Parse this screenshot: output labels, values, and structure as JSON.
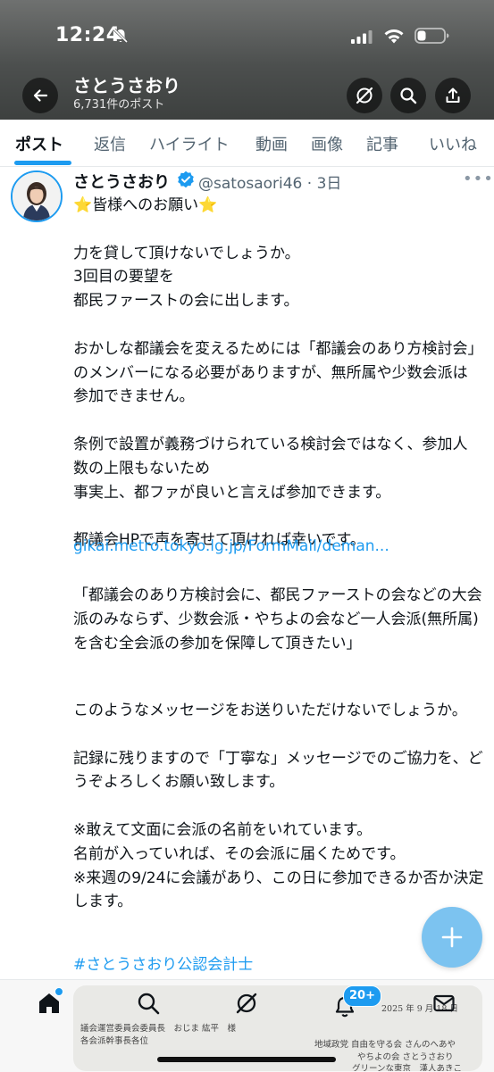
{
  "status_bar": {
    "time": "12:24"
  },
  "header": {
    "title": "さとうさおり",
    "post_count": "6,731件のポスト"
  },
  "tabs": [
    {
      "label": "ポスト"
    },
    {
      "label": "返信"
    },
    {
      "label": "ハイライト"
    },
    {
      "label": "動画"
    },
    {
      "label": "画像"
    },
    {
      "label": "記事"
    },
    {
      "label": "いいね"
    }
  ],
  "post": {
    "author": "さとうさおり",
    "handle_time": "@satosaori46 · 3日",
    "body": "⭐皆様へのお願い⭐\n\n力を貸して頂けないでしょうか。\n3回目の要望を\n都民ファーストの会に出します。\n\nおかしな都議会を変えるためには「都議会のあり方検討会」のメンバーになる必要がありますが、無所属や少数会派は参加できません。\n\n条例で設置が義務づけられている検討会ではなく、参加人数の上限もないため\n事実上、都ファが良いと言えば参加できます。\n\n都議会HPで声を寄せて頂ければ幸いです。",
    "link": "gikai.metro.tokyo.lg.jp/FormMail/deman...",
    "quote": "「都議会のあり方検討会に、都民ファーストの会などの大会派のみならず、少数会派・やちよの会など一人会派(無所属)を含む全会派の参加を保障して頂きたい」",
    "tail": "このようなメッセージをお送りいただけないでしょうか。\n\n記録に残りますので「丁寧な」メッセージでのご協力を、どうぞよろしくお願い致します。\n\n※敢えて文面に会派の名前をいれています。\n名前が入っていれば、その会派に届くためです。\n※来週の9/24に会議があり、この日に参加できるか否か決定します。",
    "hashtag": "#さとうさおり公認会計士"
  },
  "media_preview": {
    "line1": "議会運営委員会委員長　おじま 紘平　様",
    "line2": "各会派幹事長各位",
    "date": "2025 年 9 月 18 日",
    "sender1": "地域政党 自由を守る会 さんのへあや",
    "sender2": "やちよの会 さとうさおり",
    "sender3": "グリーンな東京　漢人あきこ"
  },
  "bottom_nav": {
    "notifications_count": "20+"
  },
  "colors": {
    "accent": "#1d9bf0",
    "text": "#0f1419",
    "muted": "#536471"
  }
}
